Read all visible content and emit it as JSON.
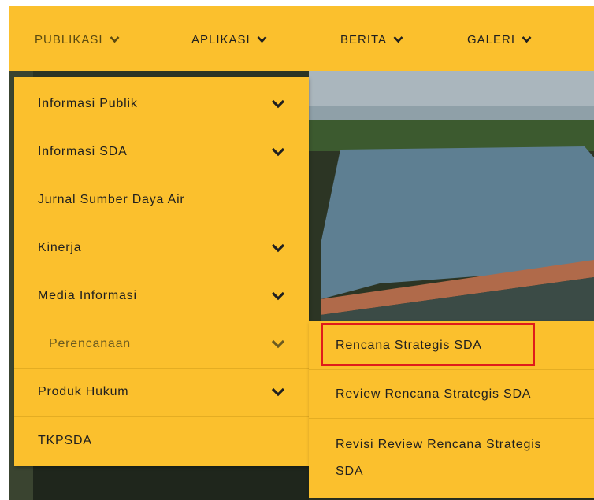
{
  "topnav": {
    "items": [
      {
        "label": "PUBLIKASI",
        "icon": "chevron-down-icon"
      },
      {
        "label": "APLIKASI",
        "icon": "chevron-down-icon"
      },
      {
        "label": "BERITA",
        "icon": "chevron-down-icon"
      },
      {
        "label": "GALERI",
        "icon": "chevron-down-icon"
      }
    ]
  },
  "publikasi_menu": {
    "items": [
      {
        "label": "Informasi Publik",
        "has_submenu": true
      },
      {
        "label": "Informasi SDA",
        "has_submenu": true
      },
      {
        "label": "Jurnal Sumber Daya Air",
        "has_submenu": false
      },
      {
        "label": "Kinerja",
        "has_submenu": true
      },
      {
        "label": "Media Informasi",
        "has_submenu": true
      },
      {
        "label": "Perencanaan",
        "has_submenu": true
      },
      {
        "label": "Produk Hukum",
        "has_submenu": true
      },
      {
        "label": "TKPSDA",
        "has_submenu": false
      }
    ]
  },
  "perencanaan_submenu": {
    "items": [
      {
        "label": "Rencana Strategis SDA"
      },
      {
        "label": "Review Rencana Strategis SDA"
      },
      {
        "label": "Revisi Review Rencana Strategis SDA"
      }
    ]
  },
  "colors": {
    "menu_bg": "#fbc02d",
    "highlight_border": "#e01b1b",
    "text": "#1f1f1f"
  }
}
